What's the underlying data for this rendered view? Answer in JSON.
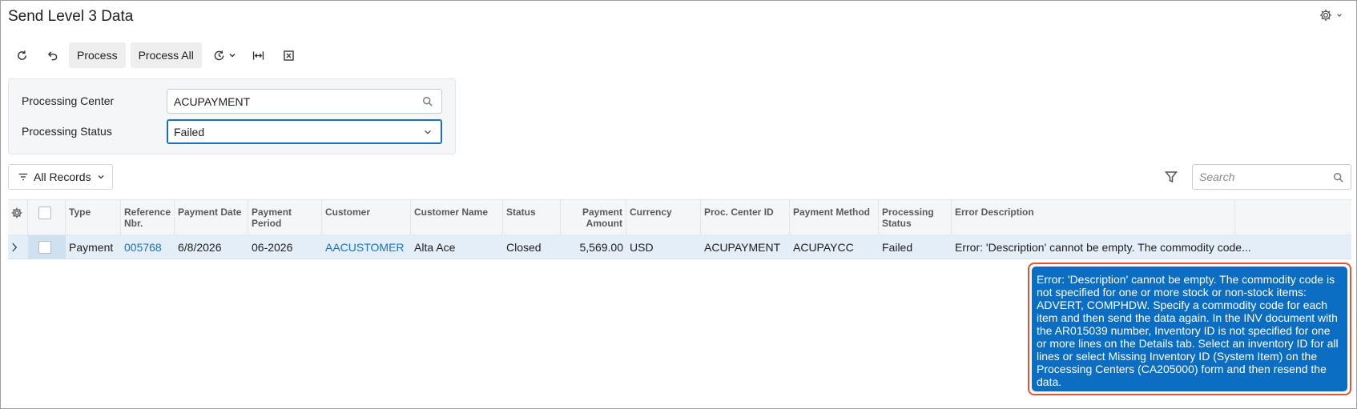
{
  "page": {
    "title": "Send Level 3 Data"
  },
  "toolbar": {
    "process_label": "Process",
    "process_all_label": "Process All"
  },
  "filters": {
    "processing_center_label": "Processing Center",
    "processing_center_value": "ACUPAYMENT",
    "processing_status_label": "Processing Status",
    "processing_status_value": "Failed"
  },
  "records_filter": {
    "label": "All Records"
  },
  "search": {
    "placeholder": "Search"
  },
  "grid": {
    "headers": {
      "type": "Type",
      "reference_nbr": "Reference Nbr.",
      "payment_date": "Payment Date",
      "payment_period": "Payment Period",
      "customer": "Customer",
      "customer_name": "Customer Name",
      "status": "Status",
      "payment_amount": "Payment Amount",
      "currency": "Currency",
      "proc_center_id": "Proc. Center ID",
      "payment_method": "Payment Method",
      "processing_status": "Processing Status",
      "error_description": "Error Description"
    },
    "rows": [
      {
        "type": "Payment",
        "reference_nbr": "005768",
        "payment_date": "6/8/2026",
        "payment_period": "06-2026",
        "customer": "AACUSTOMER",
        "customer_name": "Alta Ace",
        "status": "Closed",
        "payment_amount": "5,569.00",
        "currency": "USD",
        "proc_center_id": "ACUPAYMENT",
        "payment_method": "ACUPAYCC",
        "processing_status": "Failed",
        "error_description": "Error: 'Description' cannot be empty. The commodity code..."
      }
    ]
  },
  "tooltip": {
    "text": "Error: 'Description' cannot be empty. The commodity code is not specified for one or more stock or non-stock items: ADVERT, COMPHDW. Specify a commodity code for each item and then send the data again. In the INV document with the AR015039 number, Inventory ID is not specified for one or more lines on the Details tab. Select an inventory ID for all lines or select Missing Inventory ID (System Item) on the Processing Centers (CA205000) form and then resend the data."
  },
  "colors": {
    "accent": "#1f6fb5",
    "link": "#1a73b8",
    "tooltip_bg": "#0b6ec2",
    "tooltip_border": "#e2543a",
    "row_selected": "#e3eef8"
  }
}
